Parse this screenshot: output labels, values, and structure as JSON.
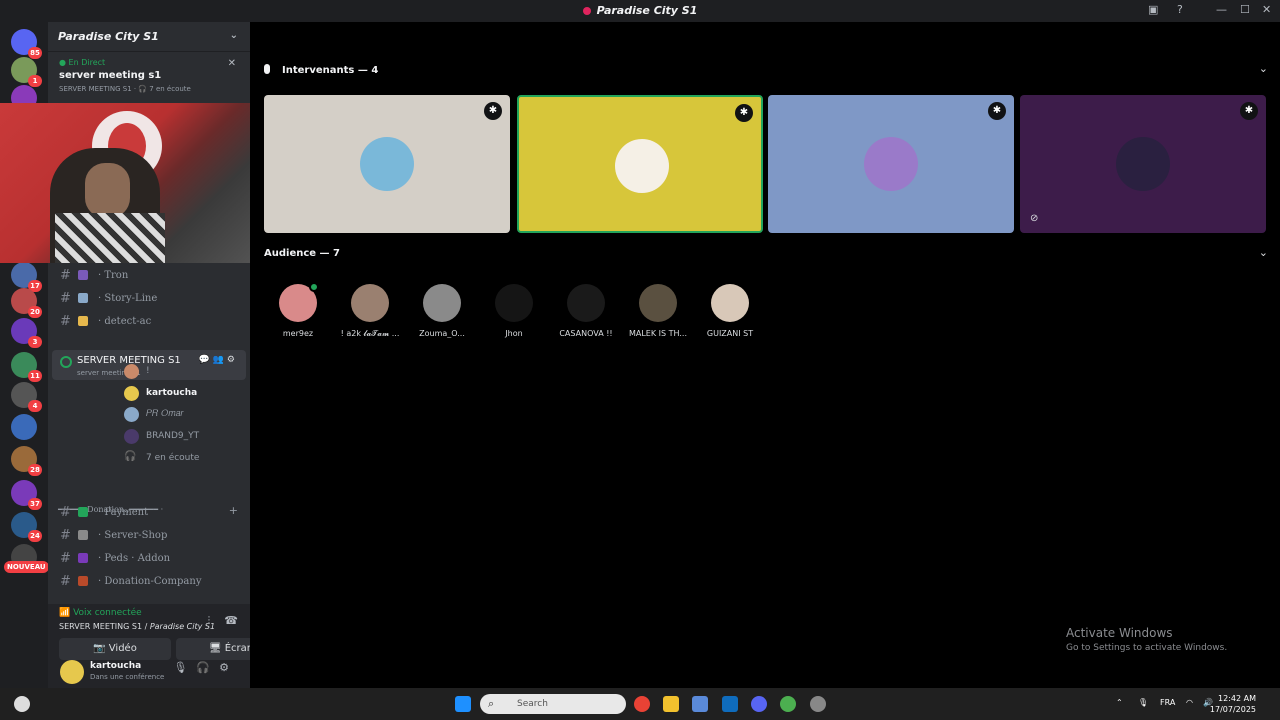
{
  "window": {
    "title": "Paradise City S1",
    "controls": [
      "—",
      "☐",
      "✕"
    ]
  },
  "guilds": [
    {
      "badge": "85",
      "color": "#5865f2"
    },
    {
      "badge": "1",
      "color": "#7a9a5a"
    },
    {
      "badge": "",
      "color": "#8a3ab9"
    },
    {
      "badge": "17",
      "color": "#4a6aa9"
    },
    {
      "badge": "20",
      "color": "#b94a4a"
    },
    {
      "badge": "3",
      "color": "#6a3ab9"
    },
    {
      "badge": "11",
      "color": "#3a8a5a"
    },
    {
      "badge": "4",
      "color": "#555555"
    },
    {
      "badge": "",
      "color": "#3a6ab9"
    },
    {
      "badge": "28",
      "color": "#9a6a3a"
    },
    {
      "badge": "37",
      "color": "#7a3ab9"
    },
    {
      "badge": "24",
      "color": "#2a5a8a"
    },
    {
      "badge": "",
      "color": "#444444"
    }
  ],
  "new_badge": "NOUVEAU",
  "server": {
    "name": "Paradise City S1"
  },
  "live": {
    "tag": "En Direct",
    "title": "server meeting s1",
    "sub": "SERVER MEETING S1 · 🎧 7 en écoute"
  },
  "channels": [
    {
      "name": "· Tron",
      "color": "#7a5ab9"
    },
    {
      "name": "· Story-Line",
      "color": "#8aa9c9"
    },
    {
      "name": "· detect-ac",
      "color": "#e6b84d"
    }
  ],
  "voice_channel": {
    "name": "SERVER MEETING S1",
    "sub": "server meeting s1",
    "actions": "💬👥⚙"
  },
  "voice_users": [
    {
      "name": "!",
      "color": "#c98a6a"
    },
    {
      "name": "kartoucha",
      "color": "#e6c84d",
      "bold": true
    },
    {
      "name": "𝑃𝑅 𝑂𝑚𝑎𝑟",
      "color": "#8aa9c9"
    },
    {
      "name": "BRAND9_YT",
      "color": "#4a3a6a",
      "muted": true
    }
  ],
  "listeners": "7 en écoute",
  "category": "━━━━━.,Donation.,━━━━━━ ·",
  "channels2": [
    {
      "name": "· Payment",
      "color": "#23a55a"
    },
    {
      "name": "· Server-Shop",
      "color": "#8a8a8a"
    },
    {
      "name": "· Peds · Addon",
      "color": "#7a3ab9"
    },
    {
      "name": "· Donation-Company",
      "color": "#b94a2a"
    }
  ],
  "voice_panel": {
    "status": "Voix connectée",
    "where_prefix": "SERVER MEETING S1 / ",
    "where_server": "Paradise City S1",
    "video": "Vidéo",
    "screen": "Écran"
  },
  "user": {
    "name": "kartoucha",
    "status": "Dans une conférence"
  },
  "speakers": {
    "title": "Intervenants — 4",
    "tiles": [
      {
        "bg": "#d4cfc7",
        "avatar": "#7ab8d9",
        "muted": false
      },
      {
        "bg": "#d7c63a",
        "avatar": "#f5f0e6",
        "muted": false
      },
      {
        "bg": "#7f98c6",
        "avatar": "#9a7ac9",
        "muted": false
      },
      {
        "bg": "#3d1c4a",
        "avatar": "#2a2040",
        "muted": true
      }
    ]
  },
  "audience": {
    "title": "Audience — 7",
    "members": [
      {
        "name": "mer9ez",
        "color": "#d98a8a",
        "live": true
      },
      {
        "name": "! a2k 𝓵𝓪𝓣𝓪𝓶 ...",
        "color": "#9a8070"
      },
      {
        "name": "Zouma_O...",
        "color": "#8a8a8a"
      },
      {
        "name": "Jhon",
        "color": "#151515"
      },
      {
        "name": "CASANOVA !!",
        "color": "#1a1a1a"
      },
      {
        "name": "MALEK IS TH...",
        "color": "#5a5040"
      },
      {
        "name": "GUIZANI ST",
        "color": "#d8c8b8"
      }
    ]
  },
  "watermark": {
    "line1": "Activate Windows",
    "line2": "Go to Settings to activate Windows."
  },
  "taskbar": {
    "search": "Search",
    "lang": "FRA",
    "time": "12:42 AM",
    "date": "17/07/2025"
  }
}
